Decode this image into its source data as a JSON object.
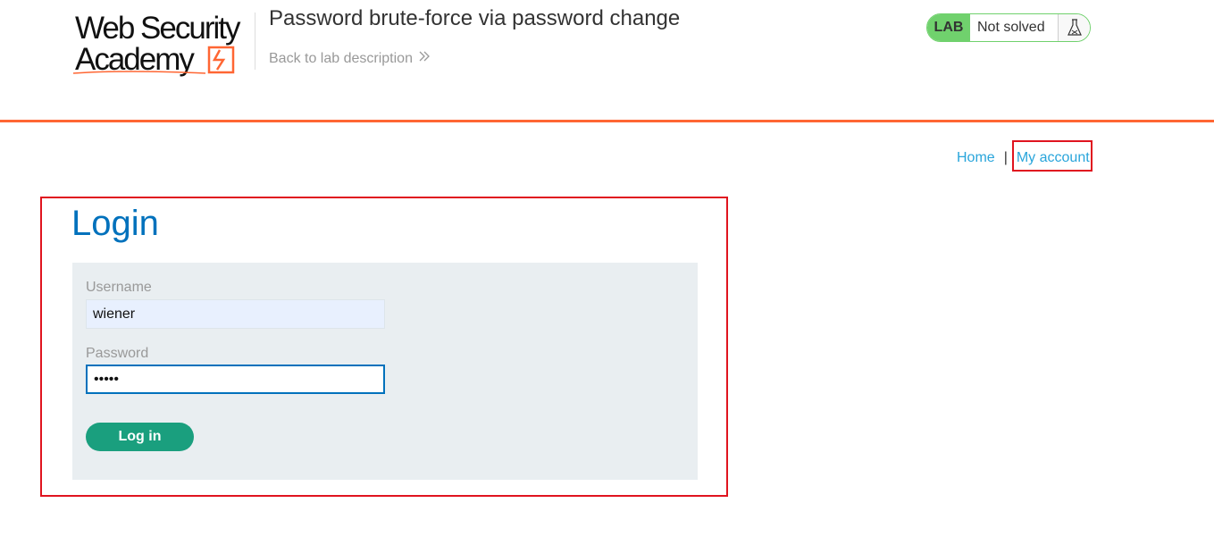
{
  "header": {
    "logo_line1": "Web Security",
    "logo_line2": "Academy",
    "lab_title": "Password brute-force via password change",
    "back_link": "Back to lab description",
    "lab_badge": "LAB",
    "lab_status": "Not solved"
  },
  "nav": {
    "home": "Home",
    "separator": "|",
    "my_account": "My account"
  },
  "login": {
    "heading": "Login",
    "username_label": "Username",
    "username_value": "wiener",
    "password_label": "Password",
    "password_value": "peter",
    "submit_label": "Log in"
  },
  "colors": {
    "accent_orange": "#ff6633",
    "link_blue": "#29a5db",
    "heading_blue": "#0071bc",
    "lab_green": "#70d16d",
    "button_green": "#1a9f7e",
    "highlight_red": "#e0141f"
  },
  "icons": {
    "back": "double-chevron-right-icon",
    "lab_status": "flask-icon",
    "logo": "web-security-academy-logo"
  }
}
